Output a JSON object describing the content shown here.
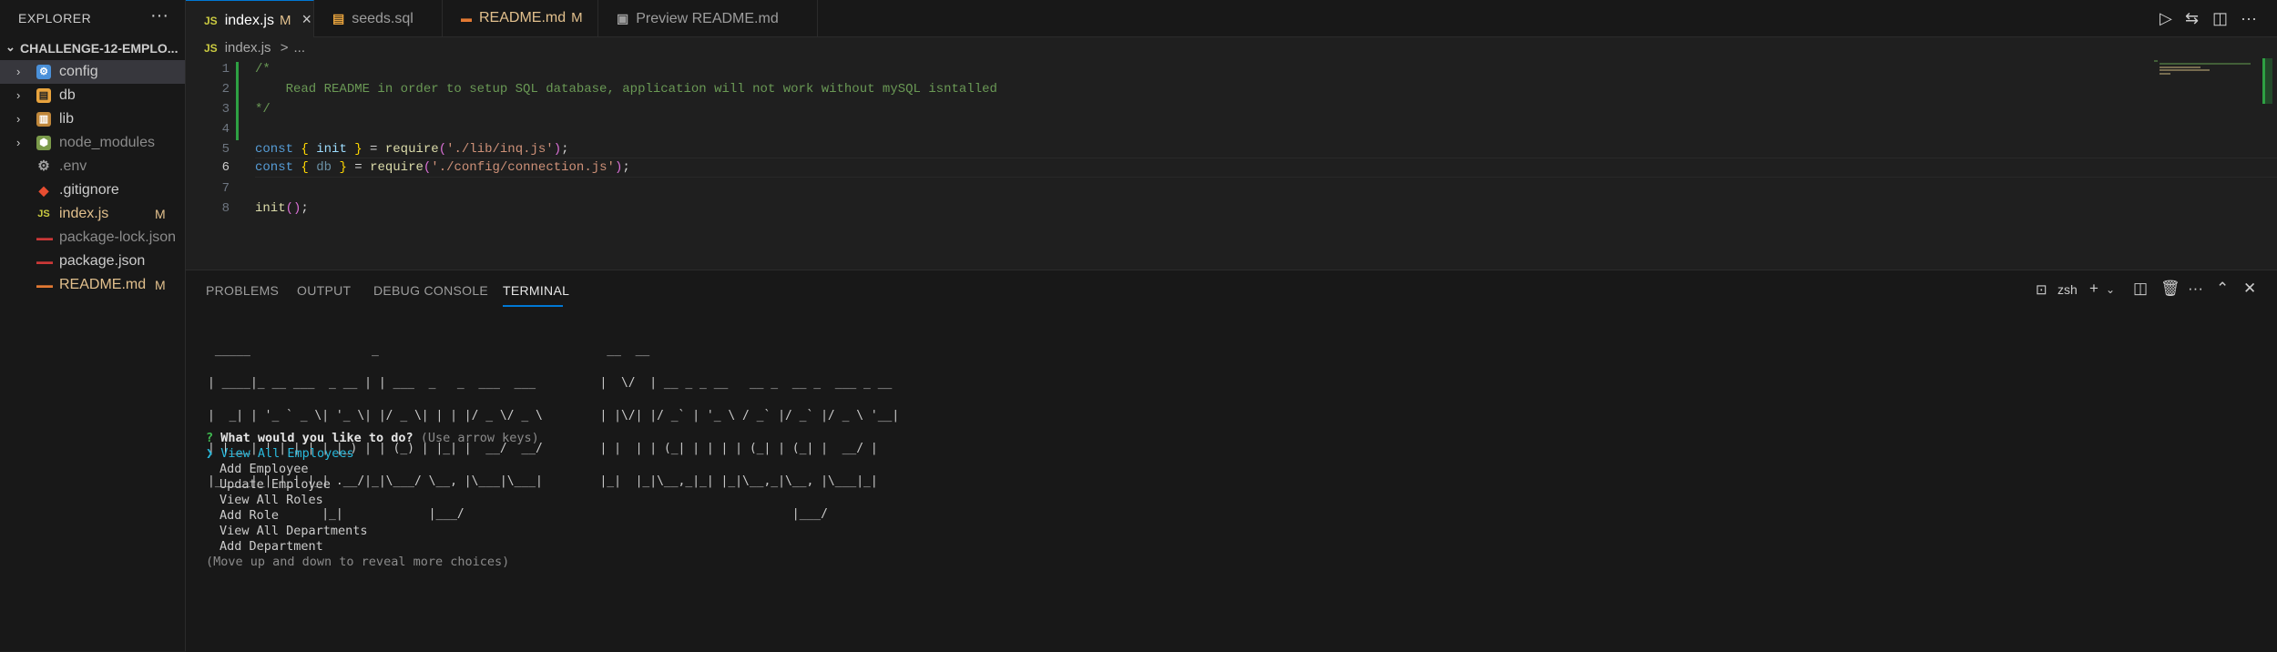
{
  "explorer": {
    "title": "EXPLORER",
    "more": "···",
    "root": "CHALLENGE-12-EMPLO...",
    "items": [
      {
        "name": "config",
        "type": "folder",
        "icon": "config-folder-icon",
        "badge": ""
      },
      {
        "name": "db",
        "type": "folder",
        "icon": "db-folder-icon",
        "badge": ""
      },
      {
        "name": "lib",
        "type": "folder",
        "icon": "lib-folder-icon",
        "badge": ""
      },
      {
        "name": "node_modules",
        "type": "folder",
        "icon": "node-folder-icon",
        "badge": ""
      },
      {
        "name": ".env",
        "type": "file",
        "icon": "gear-icon",
        "badge": ""
      },
      {
        "name": ".gitignore",
        "type": "file",
        "icon": "git-icon",
        "badge": ""
      },
      {
        "name": "index.js",
        "type": "file",
        "icon": "js-icon",
        "badge": "M"
      },
      {
        "name": "package-lock.json",
        "type": "file",
        "icon": "npm-icon",
        "badge": ""
      },
      {
        "name": "package.json",
        "type": "file",
        "icon": "npm-icon",
        "badge": ""
      },
      {
        "name": "README.md",
        "type": "file",
        "icon": "markdown-icon",
        "badge": "M"
      }
    ]
  },
  "tabs": [
    {
      "label": "index.js",
      "icon": "JS",
      "modified": "M",
      "close": "×"
    },
    {
      "label": "seeds.sql",
      "icon": "db",
      "modified": "",
      "close": ""
    },
    {
      "label": "README.md",
      "icon": "md",
      "modified": "M",
      "close": ""
    },
    {
      "label": "Preview README.md",
      "icon": "preview",
      "modified": "",
      "close": ""
    }
  ],
  "breadcrumb": {
    "icon": "JS",
    "file": "index.js",
    "sep": ">",
    "rest": "..."
  },
  "editor": {
    "lines": [
      "1",
      "2",
      "3",
      "4",
      "5",
      "6",
      "7",
      "8"
    ],
    "comment_open": "/*",
    "comment_text": "    Read README in order to setup SQL database, application will not work without mySQL isntalled",
    "comment_close": "*/",
    "l5": {
      "kw": "const",
      "open": "{",
      "name": "init",
      "close": "}",
      "eq": " = ",
      "fn": "require",
      "p1": "(",
      "str": "'./lib/inq.js'",
      "p2": ")",
      "end": ";"
    },
    "l6": {
      "kw": "const",
      "open": "{",
      "name": "db",
      "close": "}",
      "eq": " = ",
      "fn": "require",
      "p1": "(",
      "str": "'./config/connection.js'",
      "p2": ")",
      "end": ";"
    },
    "l8": {
      "fn": "init",
      "p1": "(",
      "p2": ")",
      "end": ";"
    }
  },
  "panel": {
    "tabs": [
      "PROBLEMS",
      "OUTPUT",
      "DEBUG CONSOLE",
      "TERMINAL"
    ],
    "active_tab": "TERMINAL",
    "shell": "zsh"
  },
  "terminal": {
    "ascii_art": [
      " _____                 _                                __  __                                   ",
      "| ____|_ __ ___  _ __ | | ___  _   _  ___  ___         |  \\/  | __ _ _ __   __ _  __ _  ___ _ __ ",
      "|  _| | '_ ` _ \\| '_ \\| |/ _ \\| | | |/ _ \\/ _ \\        | |\\/| |/ _` | '_ \\ / _` |/ _` |/ _ \\ '__|",
      "| |___| | | | | | |_) | | (_) | |_| |  __/  __/        | |  | | (_| | | | | (_| | (_| |  __/ |   ",
      "|_____|_| |_| |_| .__/|_|\\___/ \\__, |\\___|\\___|        |_|  |_|\\__,_|_| |_|\\__,_|\\__, |\\___|_|   ",
      "                |_|            |___/                                              |___/          "
    ],
    "prompt_mark": "?",
    "question": "What would you like to do?",
    "hint": "(Use arrow keys)",
    "pointer": "❯",
    "choices": [
      "View All Employees",
      "Add Employee",
      "Update Employee",
      "View All Roles",
      "Add Role",
      "View All Departments",
      "Add Department"
    ],
    "footer": "(Move up and down to reveal more choices)"
  }
}
